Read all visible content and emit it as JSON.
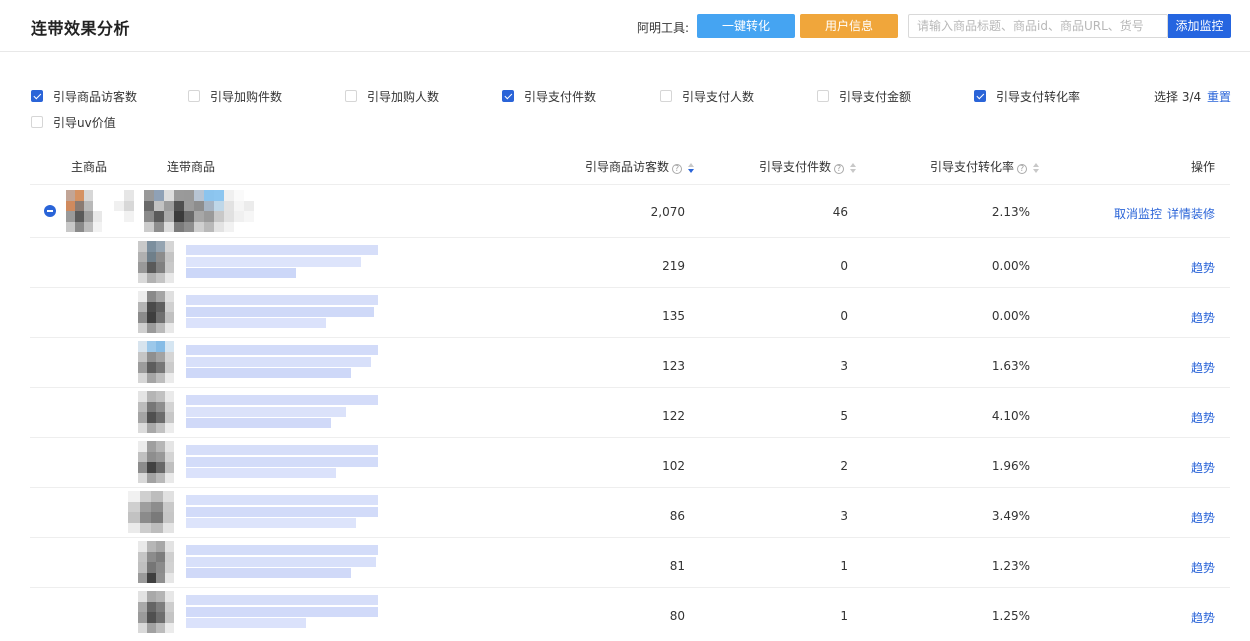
{
  "header": {
    "title": "连带效果分析",
    "tools_label": "阿明工具:",
    "btn_convert": "一键转化",
    "btn_user_info": "用户信息",
    "search_placeholder": "请输入商品标题、商品id、商品URL、货号",
    "btn_add_monitor": "添加监控"
  },
  "filters": [
    {
      "label": "引导商品访客数",
      "checked": true
    },
    {
      "label": "引导加购件数",
      "checked": false
    },
    {
      "label": "引导加购人数",
      "checked": false
    },
    {
      "label": "引导支付件数",
      "checked": true
    },
    {
      "label": "引导支付人数",
      "checked": false
    },
    {
      "label": "引导支付金额",
      "checked": false
    },
    {
      "label": "引导支付转化率",
      "checked": true
    },
    {
      "label": "引导uv价值",
      "checked": false
    }
  ],
  "selection": {
    "count_text": "选择 3/4",
    "reset": "重置"
  },
  "table": {
    "columns": {
      "main_product": "主商品",
      "related_product": "连带商品",
      "visitors": "引导商品访客数",
      "pay_count": "引导支付件数",
      "pay_rate": "引导支付转化率",
      "ops": "操作"
    },
    "main_row": {
      "visitors": "2,070",
      "pay_count": "46",
      "pay_rate": "2.13%",
      "op_cancel": "取消监控",
      "op_detail": "详情装修"
    },
    "rows": [
      {
        "visitors": "219",
        "pay_count": "0",
        "pay_rate": "0.00%",
        "op": "趋势"
      },
      {
        "visitors": "135",
        "pay_count": "0",
        "pay_rate": "0.00%",
        "op": "趋势"
      },
      {
        "visitors": "123",
        "pay_count": "3",
        "pay_rate": "1.63%",
        "op": "趋势"
      },
      {
        "visitors": "122",
        "pay_count": "5",
        "pay_rate": "4.10%",
        "op": "趋势"
      },
      {
        "visitors": "102",
        "pay_count": "2",
        "pay_rate": "1.96%",
        "op": "趋势"
      },
      {
        "visitors": "86",
        "pay_count": "3",
        "pay_rate": "3.49%",
        "op": "趋势"
      },
      {
        "visitors": "81",
        "pay_count": "1",
        "pay_rate": "1.23%",
        "op": "趋势"
      },
      {
        "visitors": "80",
        "pay_count": "1",
        "pay_rate": "1.25%",
        "op": "趋势"
      }
    ]
  }
}
